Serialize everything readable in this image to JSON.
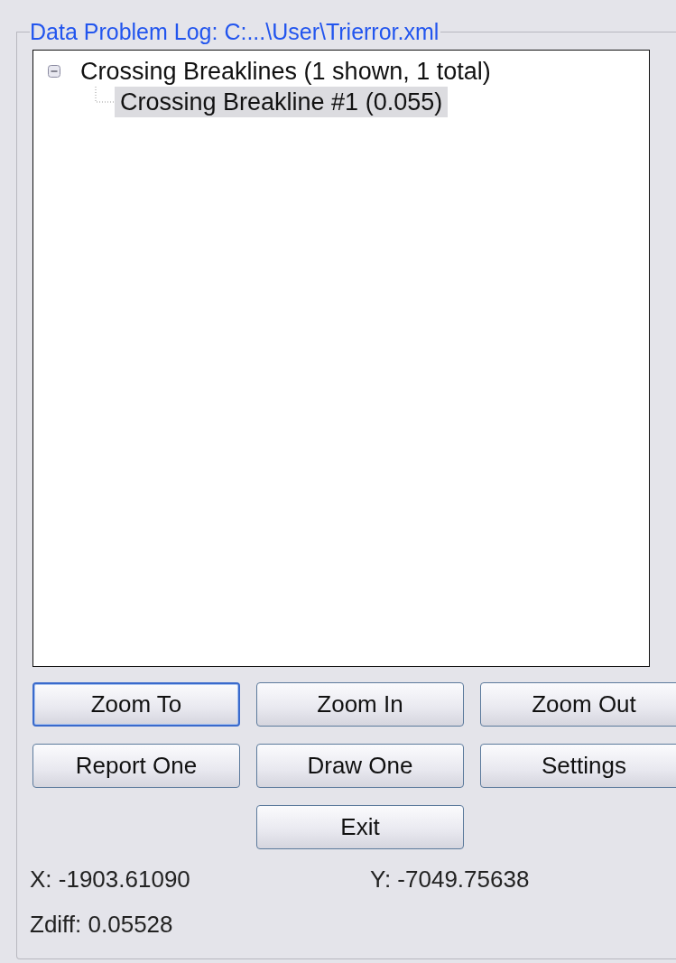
{
  "group_title": "Data Problem Log: C:...\\User\\Trierror.xml",
  "tree": [
    {
      "label": "Crossing Breaklines (1 shown, 1 total)",
      "expanded": true,
      "selected": false,
      "children": [
        {
          "label": "Crossing Breakline #1 (0.055)",
          "selected": true
        }
      ]
    }
  ],
  "buttons": [
    {
      "label": "Zoom To",
      "focused": true
    },
    {
      "label": "Zoom In",
      "focused": false
    },
    {
      "label": "Zoom Out",
      "focused": false
    },
    {
      "label": "Report One",
      "focused": false
    },
    {
      "label": "Draw One",
      "focused": false
    },
    {
      "label": "Settings",
      "focused": false
    },
    {
      "label": "Exit",
      "focused": false
    }
  ],
  "readouts": [
    {
      "label": "X: -1903.61090"
    },
    {
      "label": "Y: -7049.75638"
    },
    {
      "label": "Zdiff: 0.05528"
    }
  ]
}
